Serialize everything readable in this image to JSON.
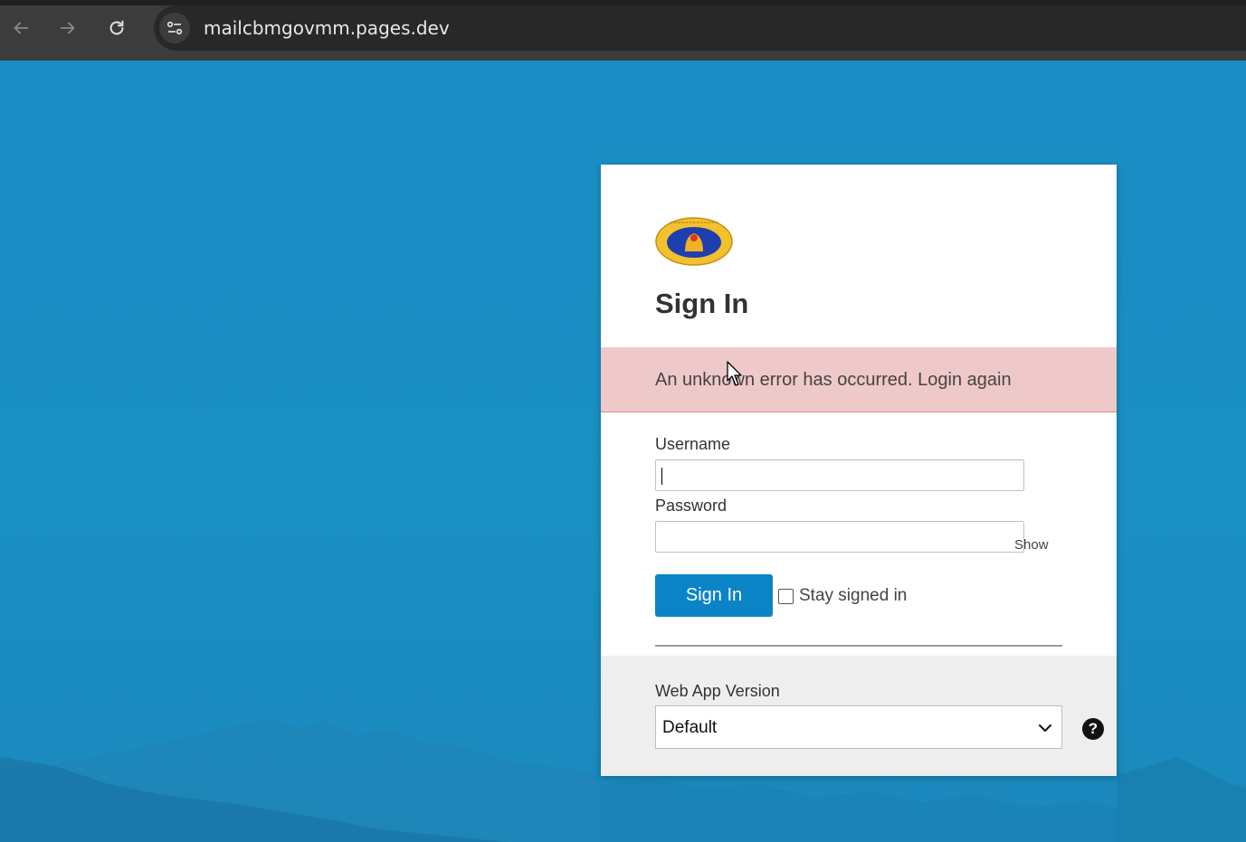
{
  "browser": {
    "url": "mailcbmgovmm.pages.dev",
    "icons": {
      "back": "arrow-left-icon",
      "forward": "arrow-right-icon",
      "reload": "reload-icon",
      "site_info": "tune-icon"
    }
  },
  "login": {
    "title": "Sign In",
    "error_message": "An unknown error has occurred. Login again",
    "username": {
      "label": "Username",
      "value": ""
    },
    "password": {
      "label": "Password",
      "value": "",
      "show_label": "Show"
    },
    "signin_button": "Sign In",
    "stay_signed_in": {
      "label": "Stay signed in",
      "checked": false
    },
    "version": {
      "label": "Web App Version",
      "selected": "Default"
    }
  },
  "colors": {
    "accent": "#0a84c6",
    "error_bg": "#efc9c9",
    "page_bg": "#1a8fc4"
  }
}
